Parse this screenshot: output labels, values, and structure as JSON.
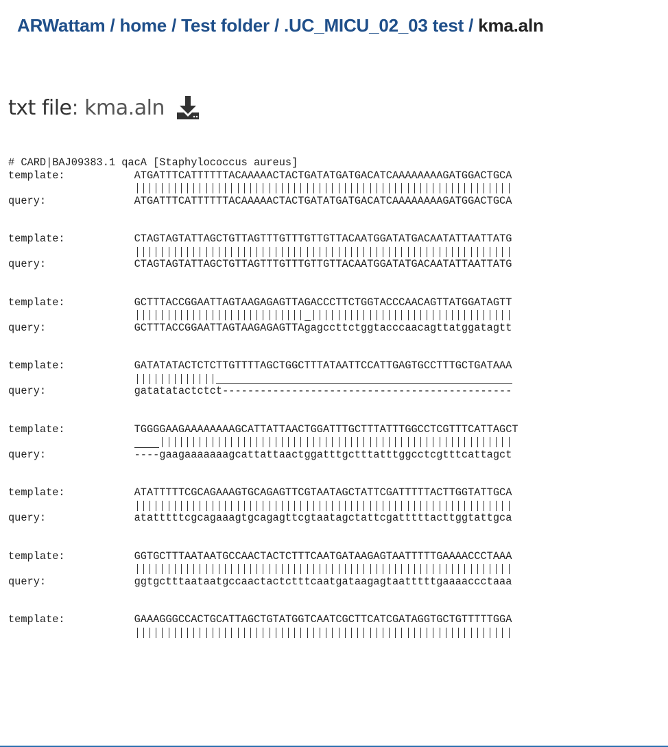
{
  "breadcrumb": {
    "items": [
      "ARWattam",
      "home",
      "Test folder",
      ".UC_MICU_02_03 test"
    ],
    "separator": "/",
    "current": "kma.aln"
  },
  "file": {
    "kind_label": "txt file",
    "name": "kma.aln",
    "download_icon": "download-icon"
  },
  "alignment": {
    "header": "# CARD|BAJ09383.1 qacA [Staphylococcus aureus]",
    "template_label": "template:",
    "query_label": "query:",
    "blocks": [
      {
        "template": "ATGATTTCATTTTTTACAAAAACTACTGATATGATGACATCAAAAAAAAGATGGACTGCA",
        "match": "||||||||||||||||||||||||||||||||||||||||||||||||||||||||||||",
        "query": "ATGATTTCATTTTTTACAAAAACTACTGATATGATGACATCAAAAAAAAGATGGACTGCA"
      },
      {
        "template": "CTAGTAGTATTAGCTGTTAGTTTGTTTGTTGTTACAATGGATATGACAATATTAATTATG",
        "match": "||||||||||||||||||||||||||||||||||||||||||||||||||||||||||||",
        "query": "CTAGTAGTATTAGCTGTTAGTTTGTTTGTTGTTACAATGGATATGACAATATTAATTATG"
      },
      {
        "template": "GCTTTACCGGAATTAGTAAGAGAGTTAGACCCTTCTGGTACCCAACAGTTATGGATAGTT",
        "match": "|||||||||||||||||||||||||||_||||||||||||||||||||||||||||||||",
        "query": "GCTTTACCGGAATTAGTAAGAGAGTTAgagccttctggtacccaacagttatggatagtt"
      },
      {
        "template": "GATATATACTCTCTTGTTTTAGCTGGCTTTATAATTCCATTGAGTGCCTTTGCTGATAAA",
        "match": "|||||||||||||_______________________________________________",
        "query": "gatatatactctct----------------------------------------------"
      },
      {
        "template": "TGGGGAAGAAAAAAAAGCATTATTAACTGGATTTGCTTTATTTGGCCTCGTTTCATTAGCT",
        "match": "____||||||||||||||||||||||||||||||||||||||||||||||||||||||||",
        "query": "----gaagaaaaaaagcattattaactggatttgctttatttggcctcgtttcattagct"
      },
      {
        "template": "ATATTTTTCGCAGAAAGTGCAGAGTTCGTAATAGCTATTCGATTTTTACTTGGTATTGCA",
        "match": "||||||||||||||||||||||||||||||||||||||||||||||||||||||||||||",
        "query": "atatttttcgcagaaagtgcagagttcgtaatagctattcgatttttacttggtattgca"
      },
      {
        "template": "GGTGCTTTAATAATGCCAACTACTCTTTCAATGATAAGAGTAATTTTTGAAAACCCTAAA",
        "match": "||||||||||||||||||||||||||||||||||||||||||||||||||||||||||||",
        "query": "ggtgctttaataatgccaactactctttcaatgataagagtaatttttgaaaaccctaaa"
      },
      {
        "template": "GAAAGGGCCACTGCATTAGCTGTATGGTCAATCGCTTCATCGATAGGTGCTGTTTTTGGA",
        "match": "||||||||||||||||||||||||||||||||||||||||||||||||||||||||||||",
        "query": ""
      }
    ]
  },
  "colors": {
    "link": "#1f4f8a",
    "text": "#222222",
    "accent_rule": "#2a6fb0"
  }
}
